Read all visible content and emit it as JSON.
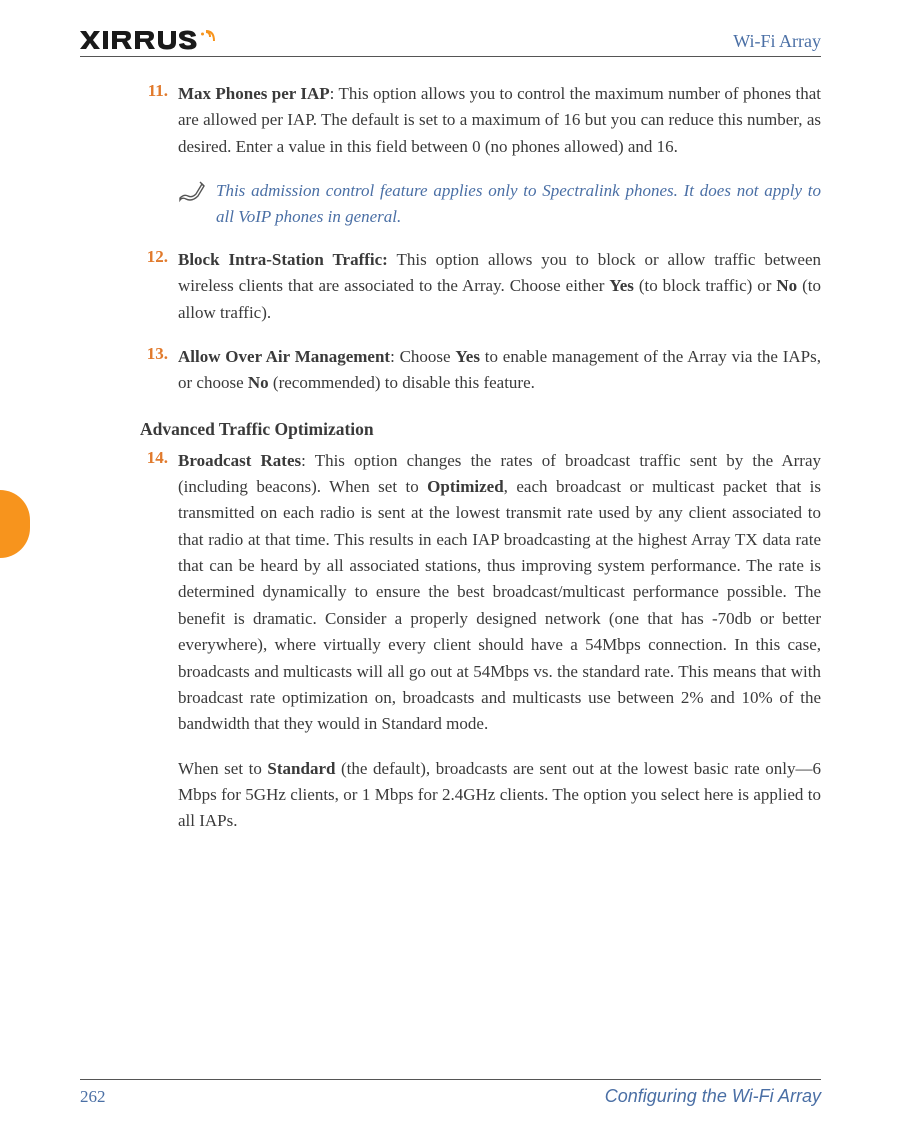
{
  "header": {
    "brand": "XIRRUS",
    "right": "Wi-Fi Array"
  },
  "items": [
    {
      "num": "11.",
      "title": "Max Phones per IAP",
      "sep": ": ",
      "body": "This option allows you to control the maximum number of phones that are allowed per IAP. The default is set to a maximum of 16 but you can reduce this number, as desired. Enter a value in this field between 0 (no phones allowed) and 16."
    },
    {
      "num": "12.",
      "title": "Block Intra-Station Traffic:",
      "sep": " ",
      "body_html": "This option allows you to block or allow traffic between wireless clients that are associated to the Array. Choose either <span class=\"b\">Yes</span> (to block traffic) or <span class=\"b\">No</span> (to allow traffic)."
    },
    {
      "num": "13.",
      "title": "Allow Over Air Management",
      "sep": ": ",
      "body_html": "Choose <span class=\"b\">Yes</span> to enable management of the Array via the IAPs, or choose <span class=\"b\">No</span> (recommended) to disable this feature."
    }
  ],
  "note": "This admission control feature applies only to Spectralink phones. It does not apply to all VoIP phones in general.",
  "section_heading": "Advanced Traffic Optimization",
  "item14": {
    "num": "14.",
    "title": "Broadcast Rates",
    "sep": ": ",
    "body_html": "This option changes the rates of broadcast traffic sent by the Array (including beacons). When set to <span class=\"b\">Optimized</span>, each broadcast or multicast packet that is transmitted on each radio is sent at the lowest transmit rate used by any client associated to that radio at that time. This results in each IAP broadcasting at the highest Array TX data rate that can be heard by all associated stations, thus improving system performance. The rate is determined dynamically to ensure the best broadcast/multicast performance possible. The benefit is dramatic. Consider a properly designed network (one that has -70db or better everywhere), where virtually every client should have a 54Mbps connection. In this case, broadcasts and multicasts will all go out at 54Mbps vs. the standard rate. This means that with broadcast rate optimization on, broadcasts and multicasts use between 2% and 10% of the bandwidth that they would in Standard mode."
  },
  "item14_para2_html": "When set to <span class=\"b\">Standard</span> (the default), broadcasts are sent out at the lowest basic rate only—6 Mbps for 5GHz clients, or 1 Mbps for 2.4GHz clients. The option you select here is applied to all IAPs.",
  "footer": {
    "page": "262",
    "title": "Configuring the Wi-Fi Array"
  }
}
